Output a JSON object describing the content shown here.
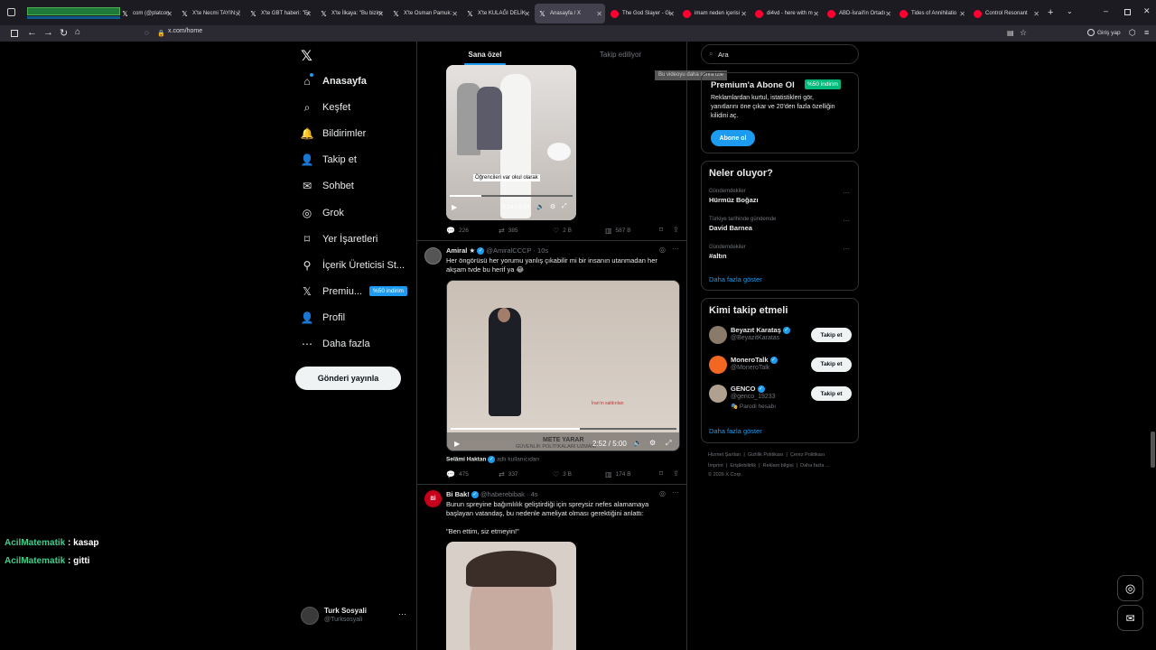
{
  "browser": {
    "tabs": [
      {
        "label": "",
        "type": "stream"
      },
      {
        "label": "com (@platcon",
        "type": "x"
      },
      {
        "label": "X'te Necmi TAYIN: \"",
        "type": "x"
      },
      {
        "label": "X'te GBT haberi: \"Er",
        "type": "x"
      },
      {
        "label": "X'te İlkaya: \"Bu bizim",
        "type": "x"
      },
      {
        "label": "X'te Osman Pamuk:",
        "type": "x"
      },
      {
        "label": "X'te KULAĞI DELİK",
        "type": "x"
      },
      {
        "label": "Anasayfa / X",
        "type": "x",
        "active": true
      },
      {
        "label": "The God Slayer - Gi",
        "type": "yt"
      },
      {
        "label": "imam neden içerisi",
        "type": "yt"
      },
      {
        "label": "di4vd - here with m",
        "type": "yt"
      },
      {
        "label": "ABD-İsrail'in Ortadı",
        "type": "yt"
      },
      {
        "label": "Tides of Annihilatio",
        "type": "yt"
      },
      {
        "label": "Control Resonant",
        "type": "yt"
      }
    ],
    "url": "x.com/home",
    "login_label": "Giriş yap"
  },
  "nav": {
    "items": [
      {
        "label": "Anasayfa",
        "icon": "home-icon",
        "bold": true
      },
      {
        "label": "Keşfet",
        "icon": "search-icon"
      },
      {
        "label": "Bildirimler",
        "icon": "bell-icon"
      },
      {
        "label": "Takip et",
        "icon": "person-add-icon"
      },
      {
        "label": "Sohbet",
        "icon": "mail-icon"
      },
      {
        "label": "Grok",
        "icon": "grok-icon"
      },
      {
        "label": "Yer İşaretleri",
        "icon": "bookmark-icon"
      },
      {
        "label": "İçerik Üreticisi St...",
        "icon": "creator-studio-icon"
      },
      {
        "label": "Premiu...",
        "icon": "x-premium-icon",
        "badge": "%50 indirim"
      },
      {
        "label": "Profil",
        "icon": "person-icon"
      },
      {
        "label": "Daha fazla",
        "icon": "more-circle-icon"
      }
    ],
    "post_button": "Gönderi yayınla",
    "account": {
      "name": "Turk Sosyali",
      "handle": "@Turksosyali"
    }
  },
  "chat_overlay": [
    {
      "user": "AcilMatematik",
      "message": " : kasap"
    },
    {
      "user": "AcilMatematik",
      "message": " : gitti"
    }
  ],
  "feed": {
    "tabs": [
      "Sana özel",
      "Takip ediliyor"
    ],
    "tweet1": {
      "video_caption": "Öğrencileri var okul olarak",
      "video_time": "0:14 / 0:54",
      "reply": "226",
      "retweet": "385",
      "like": "2 B",
      "views": "587 B"
    },
    "tweet2": {
      "name": "Amiral",
      "handle": "@AmiralCCCP",
      "time": "· 10s",
      "text_line1": "Her öngörüsü her yorumu yanlış çıkabilir mi bir insanın utanmadan her",
      "text_line2": "akşam tvde bu herif ya 😂",
      "video_time": "2:52 / 5:00",
      "video_lower_title": "METE YARAR",
      "video_lower_sub": "GÜVENLİK POLİTİKALARI UZMANI",
      "screen_text1": "İran'ın saldırıları",
      "attribution_name": "Selâmi Haktan",
      "attribution_suffix": "adlı kullanıcıdan",
      "reply": "475",
      "retweet": "337",
      "like": "3 B",
      "views": "174 B"
    },
    "tweet3": {
      "name": "Bi Bak!",
      "handle": "@haberebibak",
      "time": "· 4s",
      "text_line1": "Burun spreyine bağımlılık geliştirdiği için spreysiz nefes alamamaya",
      "text_line2": "başlayan vatandaş, bu nedenle ameliyat olması gerektiğini anlattı:",
      "quote": "\"Ben ettim, siz etmeyin!\""
    }
  },
  "right": {
    "search_placeholder": "Ara",
    "video_notice": "Bu videoyu daha sonra izle",
    "premium": {
      "title": "Premium'a Abone Ol",
      "badge": "%50 indirim",
      "desc_line1": "Reklamlardan kurtul, istatistikleri gör,",
      "desc_line2": "yanıtlarını öne çıkar ve 20'den fazla özelliğin",
      "desc_line3": "kilidini aç.",
      "button": "Abone ol"
    },
    "trends": {
      "title": "Neler oluyor?",
      "items": [
        {
          "context": "Gündemdekiler",
          "name": "Hürmüz Boğazı"
        },
        {
          "context": "Türkiye tarihinde gündemde",
          "name": "David Barnea"
        },
        {
          "context": "Gündemdekiler",
          "name": "#altın"
        }
      ],
      "more": "Daha fazla göster"
    },
    "who_to_follow": {
      "title": "Kimi takip etmeli",
      "items": [
        {
          "name": "Beyazıt Karataş",
          "handle": "@BeyazitKaratas",
          "button": "Takip et"
        },
        {
          "name": "MoneroTalk",
          "handle": "@MoneroTalk",
          "button": "Takip et"
        },
        {
          "name": "GENCO",
          "handle": "@genco_19233",
          "note": "Parodi hesabı",
          "button": "Takip et"
        }
      ],
      "more": "Daha fazla göster"
    },
    "footer": {
      "line1": [
        "Hizmet Şartları",
        "Gizlilik Politikası",
        "Çerez Politikası"
      ],
      "line2": [
        "İmprint",
        "Erişilebilirlik",
        "Reklam bilgisi",
        "Daha fazla ..."
      ],
      "copyright": "© 2026 X Corp."
    }
  },
  "colors": {
    "accent": "#1d9bf0",
    "bg": "#000000",
    "border": "#2f3336",
    "chat_user": "#3ecf8e"
  }
}
